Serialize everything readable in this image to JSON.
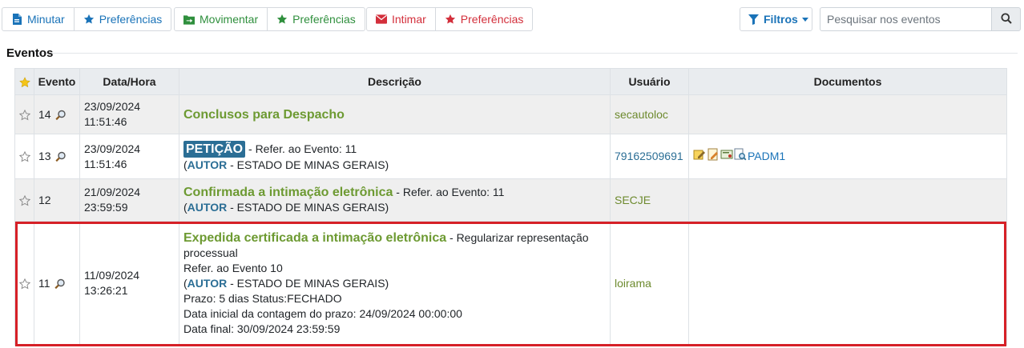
{
  "toolbar": {
    "group1": {
      "minutar": "Minutar",
      "preferencias": "Preferências"
    },
    "group2": {
      "movimentar": "Movimentar",
      "preferencias": "Preferências"
    },
    "group3": {
      "intimar": "Intimar",
      "preferencias": "Preferências"
    },
    "filters": "Filtros",
    "search_placeholder": "Pesquisar nos eventos"
  },
  "section_title": "Eventos",
  "table": {
    "headers": {
      "evento": "Evento",
      "data_hora": "Data/Hora",
      "descricao": "Descrição",
      "usuario": "Usuário",
      "documentos": "Documentos"
    },
    "rows": [
      {
        "evento": "14",
        "date": "23/09/2024",
        "time": "11:51:46",
        "title": "Conclusos para Despacho",
        "usuario": "secautoloc"
      },
      {
        "evento": "13",
        "date": "23/09/2024",
        "time": "11:51:46",
        "title": "PETIÇÃO",
        "refer": " - Refer. ao Evento: 11",
        "paren_open": "(",
        "autor": "AUTOR",
        "autor_rest": " - ESTADO DE MINAS GERAIS)",
        "usuario": "79162509691",
        "doc_link": "PADM1"
      },
      {
        "evento": "12",
        "date": "21/09/2024",
        "time": "23:59:59",
        "title": "Confirmada a intimação eletrônica",
        "refer": " - Refer. ao Evento: 11",
        "paren_open": "(",
        "autor": "AUTOR",
        "autor_rest": " - ESTADO DE MINAS GERAIS)",
        "usuario": "SECJE"
      },
      {
        "evento": "11",
        "date": "11/09/2024",
        "time": "13:26:21",
        "title": "Expedida certificada a intimação eletrônica",
        "title_rest": " - Regularizar representação processual",
        "refer": "Refer. ao Evento 10",
        "paren_open": "(",
        "autor": "AUTOR",
        "autor_rest": " - ESTADO DE MINAS GERAIS)",
        "prazo": "Prazo: 5 dias Status:FECHADO",
        "data_inicial": "Data inicial da contagem do prazo: 24/09/2024 00:00:00",
        "data_final": "Data final: 30/09/2024 23:59:59",
        "usuario": "loirama"
      }
    ]
  },
  "colors": {
    "accent_blue": "#1a73b8",
    "green": "#2f8f3d",
    "red": "#d32f3b",
    "title_green": "#6d9a32",
    "highlight_red": "#d62027"
  }
}
